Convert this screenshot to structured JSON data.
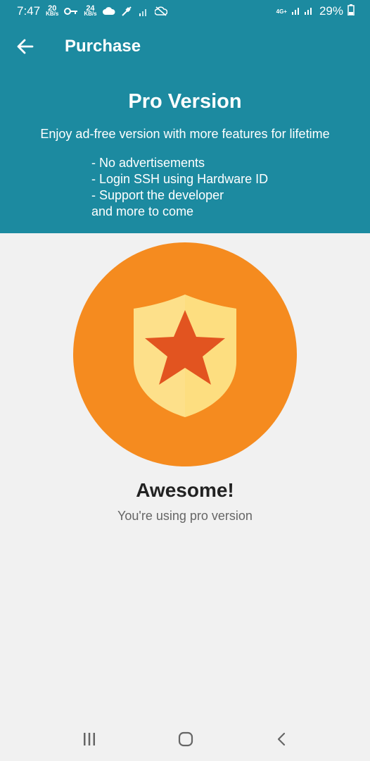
{
  "status_bar": {
    "time": "7:47",
    "speed_up_value": "20",
    "speed_up_unit": "KB/s",
    "speed_down_value": "24",
    "speed_down_unit": "KB/s",
    "network": "4G+",
    "battery": "29%"
  },
  "app_bar": {
    "title": "Purchase",
    "back_icon": "arrow-left-icon"
  },
  "header": {
    "title": "Pro Version",
    "subtitle": "Enjoy ad-free version with more features for lifetime",
    "features": [
      "- No advertisements",
      "- Login SSH using Hardware ID",
      "- Support the developer",
      "and more to come"
    ]
  },
  "badge": {
    "icon": "shield-star-icon",
    "circle_color": "#f58b1f",
    "shield_color": "#fde08a",
    "star_color": "#e25420"
  },
  "status": {
    "title": "Awesome!",
    "message": "You're using pro version"
  },
  "colors": {
    "accent": "#1c8aa0",
    "background": "#f1f1f1"
  },
  "nav_bar": {
    "recents_icon": "recents-icon",
    "home_icon": "home-icon",
    "back_icon": "back-chevron-icon"
  }
}
